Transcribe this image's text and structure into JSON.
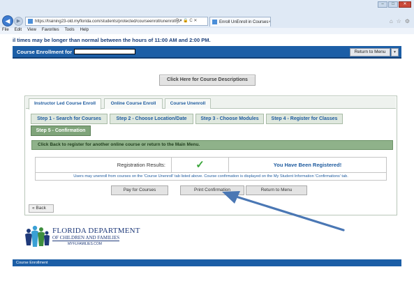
{
  "browser": {
    "url": "https://training23-old.myflorida.com/students/protected/courseenroll/unenroll.js",
    "tab_title": "Enroll UnEnroll in Courses",
    "addr_icons": "P ▾ 🔒 C ✕",
    "menu": [
      "File",
      "Edit",
      "View",
      "Favorites",
      "Tools",
      "Help"
    ]
  },
  "ticker": "il times may be longer than normal between the hours of 11:00 AM and 2:00 PM.",
  "header": {
    "title": "Course Enrollment for",
    "return_menu_label": "Return to Menu"
  },
  "course_desc_button": "Click Here for Course Descriptions",
  "main_tabs": [
    {
      "label": "Instructor Led Course Enroll",
      "active": true
    },
    {
      "label": "Online Course Enroll",
      "active": false
    },
    {
      "label": "Course Unenroll",
      "active": false
    }
  ],
  "steps": [
    {
      "label": "Step 1 - Search for Courses",
      "active": false
    },
    {
      "label": "Step 2 - Choose Location/Date",
      "active": false
    },
    {
      "label": "Step 3 - Choose Modules",
      "active": false
    },
    {
      "label": "Step 4 - Register for Classes",
      "active": false
    },
    {
      "label": "Step 5 - Confirmation",
      "active": true
    }
  ],
  "info_message": "Click Back to register for another online course or return to the Main Menu.",
  "results": {
    "label": "Registration Results:",
    "status": "You Have Been Registered!",
    "note": "Users may unenroll from courses on the 'Course Unenroll' tab listed above. Course confirmation is displayed on the My Student Information 'Confirmations' tab."
  },
  "actions": {
    "pay": "Pay for Courses",
    "print": "Print Confirmation",
    "return": "Return to Menu"
  },
  "back_label": "« Back",
  "logo": {
    "line1": "FLORIDA DEPARTMENT",
    "line2": "OF CHILDREN AND FAMILIES",
    "line3": "MYFLFAMILIES.COM"
  },
  "footer": "Course Enrollment",
  "colors": {
    "brand_blue": "#1c5ea6",
    "step_active": "#7fa47a",
    "success_check": "#3aa63a",
    "annotation_arrow": "#4a77b4"
  }
}
